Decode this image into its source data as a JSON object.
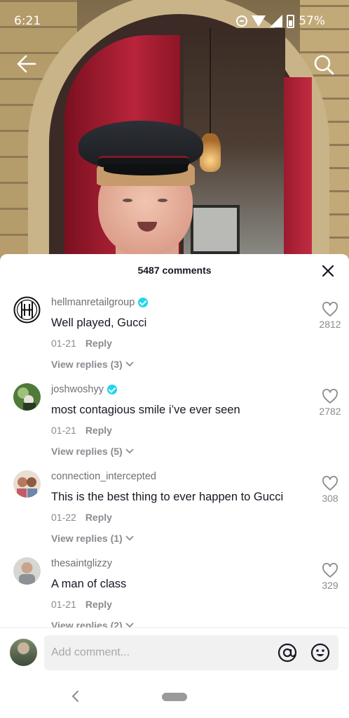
{
  "status_bar": {
    "time": "6:21",
    "battery": "57%",
    "icons": [
      "dnd-icon",
      "wifi-icon",
      "signal-icon",
      "battery-icon"
    ]
  },
  "top_nav": {
    "back_icon": "arrow-left-icon",
    "search_icon": "search-icon"
  },
  "comments_panel": {
    "title": "5487 comments",
    "close_icon": "close-icon",
    "comments": [
      {
        "username": "hellmanretailgroup",
        "verified": true,
        "text": "Well played, Gucci",
        "date": "01-21",
        "reply_label": "Reply",
        "view_replies": "View replies (3)",
        "likes": "2812"
      },
      {
        "username": "joshwoshyy",
        "verified": true,
        "text": "most contagious smile i’ve ever seen",
        "date": "01-21",
        "reply_label": "Reply",
        "view_replies": "View replies (5)",
        "likes": "2782"
      },
      {
        "username": "connection_intercepted",
        "verified": false,
        "text": "This is the best thing to ever happen to Gucci",
        "date": "01-22",
        "reply_label": "Reply",
        "view_replies": "View replies (1)",
        "likes": "308"
      },
      {
        "username": "thesaintglizzy",
        "verified": false,
        "text": "A man of class",
        "date": "01-21",
        "reply_label": "Reply",
        "view_replies": "View replies (2)",
        "likes": "329"
      }
    ]
  },
  "comment_input": {
    "placeholder": "Add comment...",
    "mention_icon": "at-sign-icon",
    "emoji_icon": "emoji-icon"
  },
  "colors": {
    "verified": "#20d5ec",
    "text_primary": "#161823",
    "text_secondary": "#8a8b91"
  }
}
